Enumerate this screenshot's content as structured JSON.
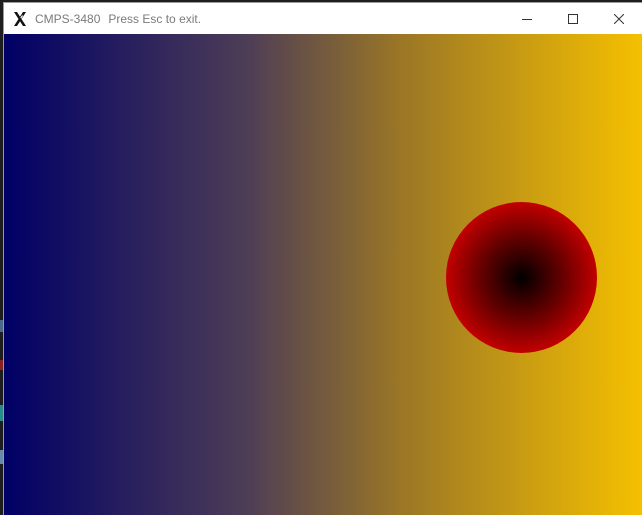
{
  "window": {
    "app_name": "CMPS-3480",
    "hint": "Press Esc to exit.",
    "icon": "x-logo-icon",
    "controls": {
      "minimize": "minimize-icon",
      "maximize": "maximize-icon",
      "close": "close-icon"
    }
  },
  "scene": {
    "gradient_colors": [
      "#000066",
      "#f5c000"
    ],
    "ball_colors": {
      "center": "#000000",
      "edge": "#ff0000"
    }
  }
}
